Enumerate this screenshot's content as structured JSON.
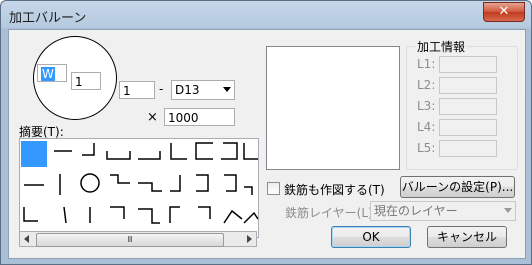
{
  "window": {
    "title": "加工バルーン",
    "close_glyph": "✕"
  },
  "balloon": {
    "bar_no": "W",
    "count": "1"
  },
  "spec": {
    "quantity": "1",
    "dash": "-",
    "diameter": "D13",
    "times": "×",
    "length": "1000"
  },
  "shape_list": {
    "label": "摘要(T):",
    "scroll_glyph": "Ⅲ"
  },
  "process_info": {
    "title": "加工情報",
    "labels": [
      "L1:",
      "L2:",
      "L3:",
      "L4:",
      "L5:"
    ]
  },
  "options": {
    "draw_rebar_label": "鉄筋も作図する(T)",
    "layer_label": "鉄筋レイヤー(L):",
    "layer_value": "現在のレイヤー"
  },
  "buttons": {
    "settings": "バルーンの設定(P)...",
    "ok": "OK",
    "cancel": "キャンセル"
  },
  "colors": {
    "selection": "#3399ff",
    "close_button": "#c13a1f"
  }
}
